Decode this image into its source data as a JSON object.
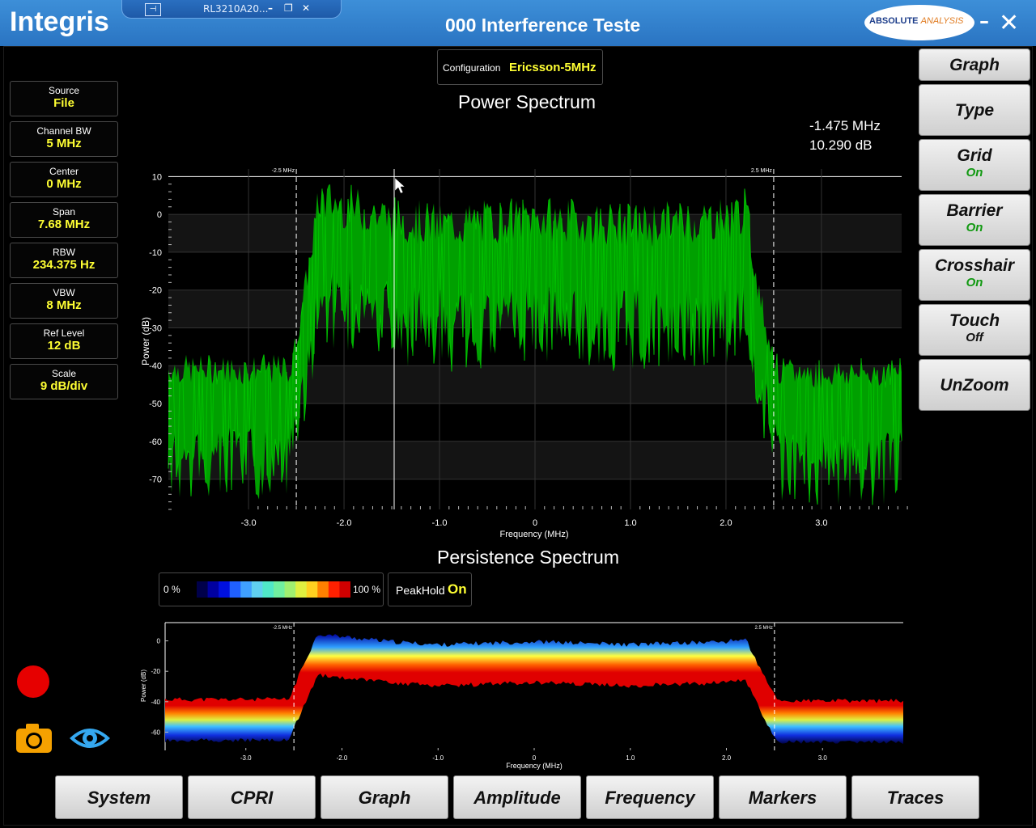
{
  "app": {
    "brand": "Integris",
    "title": "000 Interference Teste",
    "window_tab_title": "RL3210A20...",
    "logo_text_1": "ABSOLUTE",
    "logo_text_2": "ANALYSIS"
  },
  "window_controls": {
    "minimize": "–",
    "close": "✕",
    "tab_min": "–",
    "tab_restore": "❐",
    "tab_close": "✕",
    "tab_pin": "⊣"
  },
  "info_panel": [
    {
      "label": "Source",
      "value": "File"
    },
    {
      "label": "Channel BW",
      "value": "5 MHz"
    },
    {
      "label": "Center",
      "value": "0 MHz"
    },
    {
      "label": "Span",
      "value": "7.68 MHz"
    },
    {
      "label": "RBW",
      "value": "234.375 Hz"
    },
    {
      "label": "VBW",
      "value": "8 MHz"
    },
    {
      "label": "Ref Level",
      "value": "12 dB"
    },
    {
      "label": "Scale",
      "value": "9 dB/div"
    }
  ],
  "config": {
    "label": "Configuration",
    "value": "Ericsson-5MHz"
  },
  "right_menu": [
    {
      "label": "Graph",
      "state": ""
    },
    {
      "label": "Type",
      "state": ""
    },
    {
      "label": "Grid",
      "state": "On"
    },
    {
      "label": "Barrier",
      "state": "On"
    },
    {
      "label": "Crosshair",
      "state": "On"
    },
    {
      "label": "Touch",
      "state": "Off"
    },
    {
      "label": "UnZoom",
      "state": ""
    }
  ],
  "bottom_menu": [
    "System",
    "CPRI",
    "Graph",
    "Amplitude",
    "Frequency",
    "Markers",
    "Traces"
  ],
  "crosshair": {
    "freq": "-1.475 MHz",
    "power": "10.290 dB",
    "freq_value": -1.475,
    "power_value": 10.29
  },
  "legend": {
    "min": "0 %",
    "max": "100 %",
    "colors": [
      "#00004a",
      "#0000a0",
      "#0010e0",
      "#2060ff",
      "#40a0ff",
      "#60d0f0",
      "#50e8c8",
      "#70f0a0",
      "#a0f070",
      "#e0f040",
      "#ffd020",
      "#ff8000",
      "#ff2000",
      "#d00000"
    ]
  },
  "peakhold": {
    "label": "PeakHold",
    "value": "On"
  },
  "colors": {
    "trace": "#00a000",
    "accent_yellow": "#ffff33",
    "titlebar": "#2f7fcf",
    "record": "#e60000",
    "camera": "#f5a100",
    "eye": "#35a8f0"
  },
  "chart_data": [
    {
      "type": "line",
      "title": "Power Spectrum",
      "xlabel": "Frequency (MHz)",
      "ylabel": "Power (dB)",
      "xlim": [
        -3.84,
        3.84
      ],
      "ylim": [
        -78,
        12
      ],
      "yticks": [
        10,
        0,
        -10,
        -20,
        -30,
        -40,
        -50,
        -60,
        -70
      ],
      "xticks": [
        -3.0,
        -2.0,
        -1.0,
        0,
        1.0,
        2.0,
        3.0
      ],
      "barrier_labels": [
        "-2.5 MHz",
        "2.5 MHz"
      ],
      "barriers": [
        -2.5,
        2.5
      ],
      "grid": true,
      "series": [
        {
          "x": [
            -3.84,
            -3.0,
            -2.55,
            -2.5,
            -2.35,
            -2.25,
            -1.5,
            -1.0,
            0,
            1.0,
            2.0,
            2.2,
            2.35,
            2.45,
            2.55,
            3.0,
            3.84
          ],
          "y": [
            -48,
            -48,
            -48,
            -40,
            -18,
            -5,
            -10,
            -12,
            -10,
            -12,
            -10,
            -8,
            -28,
            -40,
            -49,
            -49,
            -49
          ]
        }
      ]
    },
    {
      "type": "heatmap",
      "title": "Persistence Spectrum",
      "xlabel": "Frequency (MHz)",
      "ylabel": "Power (dB)",
      "xlim": [
        -3.84,
        3.84
      ],
      "ylim": [
        -72,
        12
      ],
      "yticks": [
        0,
        -20,
        -40,
        -60
      ],
      "xticks": [
        -3.0,
        -2.0,
        -1.0,
        0,
        1.0,
        2.0,
        3.0
      ],
      "barrier_labels": [
        "-2.5 MHz",
        "2.5 MHz"
      ],
      "barriers": [
        -2.5,
        2.5
      ]
    }
  ]
}
